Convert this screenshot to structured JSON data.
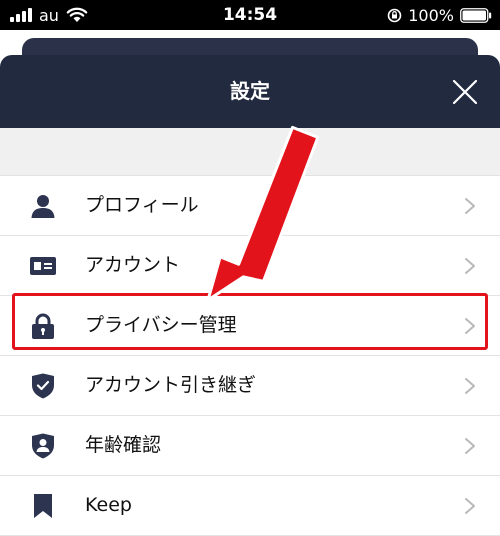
{
  "status_bar": {
    "carrier": "au",
    "time": "14:54",
    "battery": "100%",
    "icons": [
      "signal-icon",
      "wifi-icon",
      "rotation-lock-icon",
      "battery-icon"
    ]
  },
  "header": {
    "title": "設定",
    "close_icon": "close-icon"
  },
  "menu": {
    "items": [
      {
        "label": "プロフィール",
        "icon": "person-icon"
      },
      {
        "label": "アカウント",
        "icon": "id-card-icon"
      },
      {
        "label": "プライバシー管理",
        "icon": "lock-icon"
      },
      {
        "label": "アカウント引き継ぎ",
        "icon": "shield-check-icon"
      },
      {
        "label": "年齢確認",
        "icon": "age-verification-icon"
      },
      {
        "label": "Keep",
        "icon": "bookmark-icon"
      }
    ]
  },
  "annotation": {
    "highlight_color": "#e3131b",
    "highlighted_item": "プライバシー管理"
  },
  "colors": {
    "header_bg": "#222a40",
    "icon_color": "#2c3450",
    "chevron_color": "#b9b9b9"
  }
}
